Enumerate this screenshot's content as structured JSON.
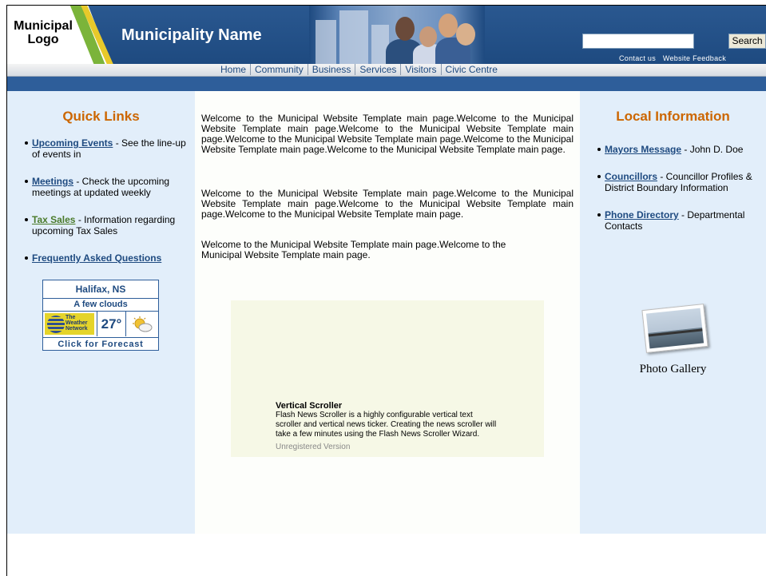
{
  "header": {
    "logo_text": "Municipal Logo",
    "municipality_name": "Municipality Name",
    "search_placeholder": "",
    "search_button": "Search",
    "top_links": [
      "Contact us",
      "Website Feedback"
    ]
  },
  "nav": {
    "items": [
      "Home",
      "Community",
      "Business",
      "Services",
      "Visitors",
      "Civic Centre"
    ]
  },
  "left": {
    "title": "Quick Links",
    "items": [
      {
        "link": "Upcoming Events",
        "desc": " - See the line-up of events in"
      },
      {
        "link": "Meetings",
        "desc": " - Check the upcoming meetings at updated weekly"
      },
      {
        "link": "Tax Sales",
        "desc": " - Information regarding upcoming Tax Sales"
      },
      {
        "link": "Frequently Asked Questions",
        "desc": ""
      }
    ],
    "weather": {
      "city": "Halifax, NS",
      "condition": "A few clouds",
      "logo_text": [
        "The",
        "Weather",
        "Network"
      ],
      "temp": "27°",
      "forecast": "Click for Forecast"
    }
  },
  "main": {
    "paragraphs": [
      "Welcome to the Municipal Website Template main page.Welcome to the Municipal Website Template main page.Welcome to the Municipal Website Template main page.Welcome to the Municipal Website Template main page.Welcome to the Municipal Website Template main page.Welcome to the Municipal Website Template main page.",
      "Welcome to the Municipal Website Template main page.Welcome to the Municipal Website Template main page.Welcome to the Municipal Website Template main page.Welcome to the Municipal Website Template main page.",
      "Welcome to the Municipal Website Template main page.Welcome to the Municipal Website Template main page."
    ],
    "scroller": {
      "title": "Vertical Scroller",
      "text": "Flash News Scroller is a highly configurable vertical text scroller and vertical news ticker. Creating the news scroller will take a few minutes using the Flash News Scroller Wizard.",
      "watermark": "Unregistered Version"
    }
  },
  "right": {
    "title": "Local Information",
    "items": [
      {
        "link": "Mayors Message",
        "desc": " - John D. Doe"
      },
      {
        "link": "Councillors",
        "desc": " - Councillor Profiles & District Boundary Information"
      },
      {
        "link": "Phone Directory",
        "desc": " - Departmental Contacts"
      }
    ],
    "gallery_label": "Photo Gallery"
  }
}
